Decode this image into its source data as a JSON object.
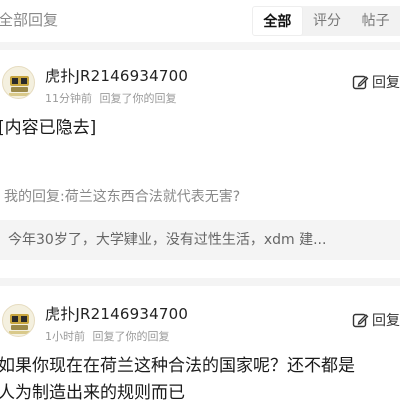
{
  "header": {
    "title": "全部回复",
    "tabs": [
      {
        "label": "全部",
        "active": true
      },
      {
        "label": "评分",
        "active": false
      },
      {
        "label": "帖子",
        "active": false
      }
    ]
  },
  "replies": [
    {
      "username": "虎扑JR2146934700",
      "time": "11分钟前",
      "action_meta": "回复了你的回复",
      "reply_label": "回复",
      "body_lines": [
        "[内容已隐去]"
      ],
      "my_reply": "我的回复:荷兰这东西合法就代表无害?",
      "quote": "今年30岁了，大学肄业，没有过性生活，xdm 建..."
    },
    {
      "username": "虎扑JR2146934700",
      "time": "1小时前",
      "action_meta": "回复了你的回复",
      "reply_label": "回复",
      "body_lines": [
        "如果你现在在荷兰这种合法的国家呢？还不都是",
        "人为制造出来的规则而已"
      ]
    }
  ],
  "colors": {
    "accent": "#111111",
    "muted": "#9a9a9a",
    "quote_bg": "#f4f4f4"
  },
  "icons": {
    "avatar": "hupu-avatar-icon",
    "reply": "edit-reply-icon"
  }
}
